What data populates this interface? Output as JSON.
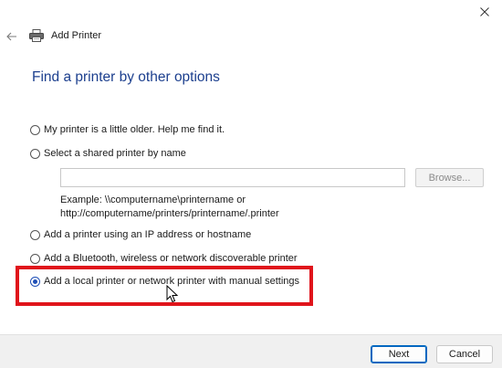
{
  "window": {
    "title": "Add Printer",
    "heading": "Find a printer by other options"
  },
  "icons": {
    "close": "close-icon",
    "back": "back-arrow-icon",
    "printer": "printer-icon",
    "cursor": "mouse-cursor-icon"
  },
  "options": [
    {
      "label": "My printer is a little older. Help me find it.",
      "checked": false
    },
    {
      "label": "Select a shared printer by name",
      "checked": false
    },
    {
      "label": "Add a printer using an IP address or hostname",
      "checked": false
    },
    {
      "label": "Add a Bluetooth, wireless or network discoverable printer",
      "checked": false
    },
    {
      "label": "Add a local printer or network printer with manual settings",
      "checked": true
    }
  ],
  "shared_printer": {
    "value": "",
    "browse_label": "Browse...",
    "example_line1": "Example: \\\\computername\\printername or",
    "example_line2": "http://computername/printers/printername/.printer"
  },
  "footer": {
    "next_label": "Next",
    "cancel_label": "Cancel"
  },
  "colors": {
    "heading": "#1c3f8e",
    "highlight": "#e0141b",
    "accent": "#1f4fb6"
  }
}
